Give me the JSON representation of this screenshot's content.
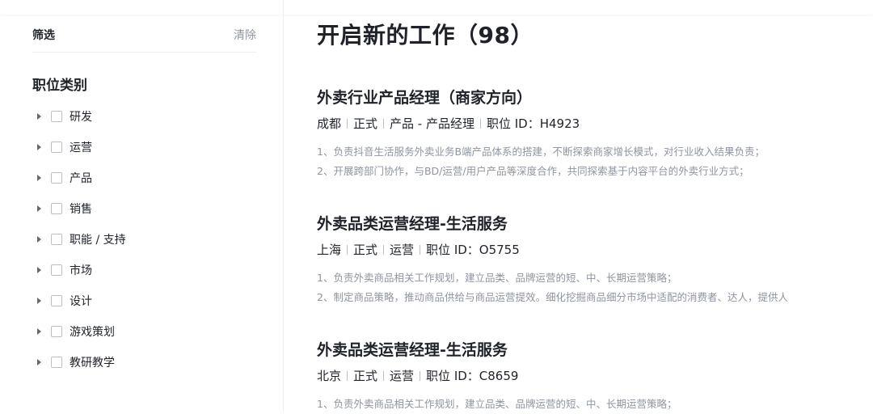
{
  "sidebar": {
    "filter_title": "筛选",
    "clear_label": "清除",
    "category_title": "职位类别",
    "categories": [
      {
        "label": "研发"
      },
      {
        "label": "运营"
      },
      {
        "label": "产品"
      },
      {
        "label": "销售"
      },
      {
        "label": "职能 / 支持"
      },
      {
        "label": "市场"
      },
      {
        "label": "设计"
      },
      {
        "label": "游戏策划"
      },
      {
        "label": "教研教学"
      }
    ]
  },
  "main": {
    "title": "开启新的工作（98）",
    "jobs": [
      {
        "title": "外卖行业产品经理（商家方向）",
        "city": "成都",
        "type": "正式",
        "category": "产品 - 产品经理",
        "job_id": "职位 ID：H4923",
        "desc": [
          "1、负责抖音生活服务外卖业务B端产品体系的搭建，不断探索商家增长模式，对行业收入结果负责；",
          "2、开展跨部门协作，与BD/运营/用户产品等深度合作，共同探索基于内容平台的外卖行业方式；"
        ]
      },
      {
        "title": "外卖品类运营经理-生活服务",
        "city": "上海",
        "type": "正式",
        "category": "运营",
        "job_id": "职位 ID：O5755",
        "desc": [
          "1、负责外卖商品相关工作规划，建立品类、品牌运营的短、中、长期运营策略；",
          "2、制定商品策略，推动商品供给与商品运营提效。细化挖掘商品细分市场中适配的消费者、达人，提供人"
        ]
      },
      {
        "title": "外卖品类运营经理-生活服务",
        "city": "北京",
        "type": "正式",
        "category": "运营",
        "job_id": "职位 ID：C8659",
        "desc": [
          "1、负责外卖商品相关工作规划，建立品类、品牌运营的短、中、长期运营策略；"
        ]
      }
    ]
  }
}
